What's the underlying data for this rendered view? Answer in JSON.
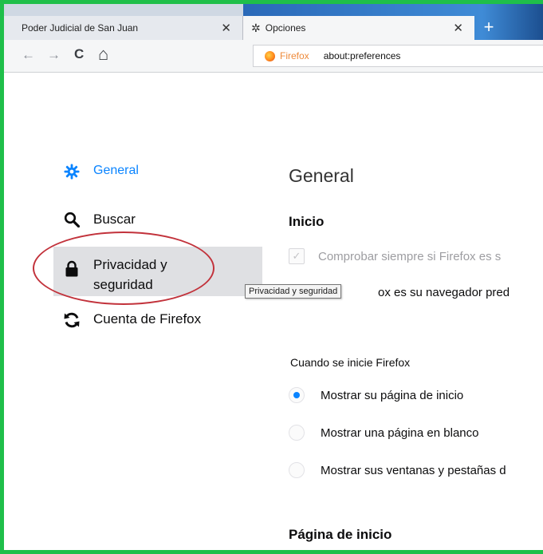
{
  "tabs": [
    {
      "title": "Poder Judicial de San Juan",
      "close": "✕"
    },
    {
      "title": "Opciones",
      "close": "✕",
      "icon": "gear-icon"
    }
  ],
  "new_tab_label": "+",
  "nav": {
    "back_icon": "←",
    "forward_icon": "→",
    "reload_icon": "C",
    "home_icon": "⌂",
    "identity_label": "Firefox",
    "url": "about:preferences"
  },
  "sidebar": {
    "items": [
      {
        "label": "General",
        "icon": "gear-icon",
        "selected": true
      },
      {
        "label": "Buscar",
        "icon": "search-icon"
      },
      {
        "label_line1": "Privacidad y",
        "label_line2": "seguridad",
        "icon": "lock-icon"
      },
      {
        "label": "Cuenta de Firefox",
        "icon": "sync-icon"
      }
    ]
  },
  "tooltip": "Privacidad y seguridad",
  "main": {
    "heading": "General",
    "section_inicio": "Inicio",
    "check_default": "Comprobar siempre si Firefox es s",
    "default_browser_text": "ox es su navegador pred",
    "startup_label": "Cuando se inicie Firefox",
    "startup_options": [
      {
        "label": "Mostrar su página de inicio",
        "selected": true
      },
      {
        "label": "Mostrar una página en blanco",
        "selected": false
      },
      {
        "label": "Mostrar sus ventanas y pestañas d",
        "selected": false
      }
    ],
    "section_homepage": "Página de inicio"
  },
  "colors": {
    "accent": "#0a84ff",
    "highlight_oval": "#c2323b",
    "frame_border": "#1fbf4a"
  }
}
